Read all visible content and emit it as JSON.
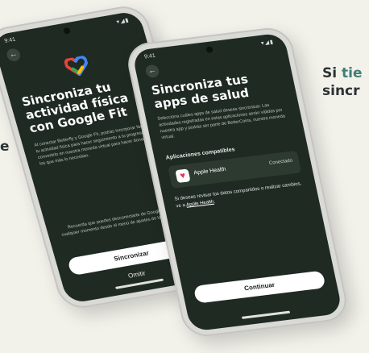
{
  "side": {
    "right_line1_prefix": "Si ",
    "right_line1_highlight": "tie",
    "right_line2": "sincr",
    "left_fragment": "e"
  },
  "phone_fit": {
    "status_time": "9:41",
    "status_icons": "▾◢▮",
    "back_icon": "←",
    "title": "Sincroniza tu actividad física con Google Fit",
    "body": "Al conectar Betterfly y Google Fit, podrás incorporar fácilmente tu actividad física para hacer seguimiento a tu progreso y convertirlo en nuestra moneda virtual para hacer donaciones a los que más lo necesitan.",
    "footer": "Recuerda que puedes desconectarte de Google Fit en cualquier momento desde el menú de ajustes de la aplicación.",
    "primary_button": "Sincronizar",
    "secondary_button": "Omitir"
  },
  "phone_salud": {
    "status_time": "9:41",
    "status_icons": "▾◢▮",
    "back_icon": "←",
    "title": "Sincroniza tus apps de salud",
    "body": "Selecciona cuáles apps de salud deseas sincronizar. Las actividades registradas en estas aplicaciones serán válidas por nuestra app y podrás ser parte de BetterCoins, nuestra moneda virtual.",
    "section_label": "Aplicaciones compatibles",
    "app": {
      "icon": "♥",
      "name": "Apple Health",
      "status": "Conectado"
    },
    "note_prefix": "Si deseas revisar los datos compartidos o realizar cambios, ve a ",
    "note_link": "Apple Health",
    "note_suffix": ".",
    "primary_button": "Continuar"
  },
  "colors": {
    "background": "#f2f1ea",
    "screen": "#1e2a22",
    "accent_teal": "#3f7e78"
  }
}
